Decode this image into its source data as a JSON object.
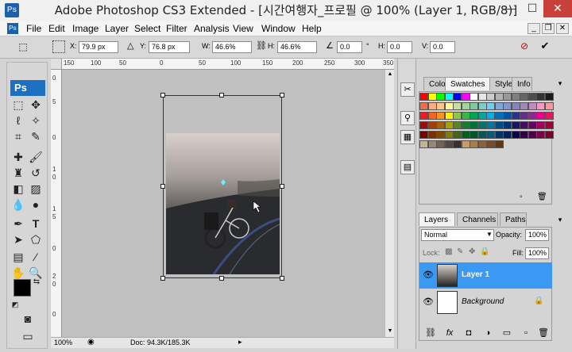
{
  "window": {
    "title": "Adobe Photoshop CS3 Extended - [시간여행자_프로필 @ 100% (Layer 1, RGB/8)]",
    "app_icon": "Ps",
    "controls": {
      "minimize": "—",
      "maximize": "☐",
      "close": "✕"
    }
  },
  "menu": {
    "items": [
      "File",
      "Edit",
      "Image",
      "Layer",
      "Select",
      "Filter",
      "Analysis",
      "View",
      "Window",
      "Help"
    ],
    "mdi": {
      "minimize": "_",
      "restore": "❐",
      "close": "✕"
    }
  },
  "options_bar": {
    "x_label": "X:",
    "x_value": "79.9 px",
    "y_label": "Y:",
    "y_value": "76.8 px",
    "w_label": "W:",
    "w_value": "46.6%",
    "h_label": "H:",
    "h_value": "46.6%",
    "angle_value": "0.0",
    "hskew_label": "H:",
    "hskew_value": "0.0",
    "vskew_label": "V:",
    "vskew_value": "0.0"
  },
  "toolbox": {
    "logo": "Ps"
  },
  "rulers": {
    "horizontal": [
      "150",
      "100",
      "50",
      "0",
      "50",
      "100",
      "150",
      "200",
      "250",
      "300",
      "350"
    ],
    "vertical": [
      "0",
      "5",
      "0",
      "1",
      "0",
      "1",
      "5",
      "0",
      "2",
      "0",
      "0"
    ]
  },
  "status": {
    "zoom": "100%",
    "doc_info": "Doc: 94.3K/185.3K"
  },
  "color_panel": {
    "tabs": [
      "Color",
      "Swatches",
      "Styles",
      "Info"
    ],
    "active_tab": "Swatches",
    "tab_close": "✕"
  },
  "swatch_rows": [
    [
      "#ff0000",
      "#ffff00",
      "#00ff00",
      "#00ffff",
      "#0000ff",
      "#ff00ff",
      "#ffffff",
      "#e6e6e6",
      "#cccccc",
      "#b3b3b3",
      "#999999",
      "#808080",
      "#666666",
      "#4d4d4d",
      "#333333",
      "#1a1a1a"
    ],
    [
      "#f26c4f",
      "#f9ad81",
      "#fdc68a",
      "#fff79a",
      "#c4df9b",
      "#a3d39c",
      "#82ca9d",
      "#7bcdc8",
      "#6ecff6",
      "#7ea7d8",
      "#8493ca",
      "#8882be",
      "#a187be",
      "#bc8dbf",
      "#f49ac2",
      "#f6989d"
    ],
    [
      "#ed1c24",
      "#f26522",
      "#f7941d",
      "#fff200",
      "#8dc63f",
      "#39b54a",
      "#00a651",
      "#00a99d",
      "#00aeef",
      "#0072bc",
      "#0054a6",
      "#2e3192",
      "#662d91",
      "#92278f",
      "#ec008c",
      "#ed145b"
    ],
    [
      "#9e0b0f",
      "#a0410d",
      "#a36209",
      "#aba000",
      "#598527",
      "#1a7b30",
      "#007236",
      "#00746b",
      "#0076a3",
      "#004b80",
      "#003471",
      "#1b1464",
      "#440e62",
      "#630460",
      "#9e005d",
      "#9e0039"
    ],
    [
      "#790000",
      "#7b2e00",
      "#7d4900",
      "#827b00",
      "#406618",
      "#005e20",
      "#005826",
      "#005952",
      "#005b7f",
      "#003663",
      "#002157",
      "#0d004c",
      "#32004b",
      "#4b0049",
      "#7b0046",
      "#7a0026"
    ],
    [
      "#c7b299",
      "#998675",
      "#736357",
      "#534741",
      "#37302d",
      "#c69c6d",
      "#a67c52",
      "#8c6239",
      "#754c24",
      "#603913"
    ]
  ],
  "layers_panel": {
    "tabs": [
      "Layers",
      "Channels",
      "Paths"
    ],
    "active_tab": "Layers",
    "blend_mode": "Normal",
    "opacity_label": "Opacity:",
    "opacity_value": "100%",
    "lock_label": "Lock:",
    "fill_label": "Fill:",
    "fill_value": "100%",
    "layers": [
      {
        "name": "Layer 1",
        "selected": true,
        "italic": false
      },
      {
        "name": "Background",
        "selected": false,
        "italic": true
      }
    ]
  }
}
